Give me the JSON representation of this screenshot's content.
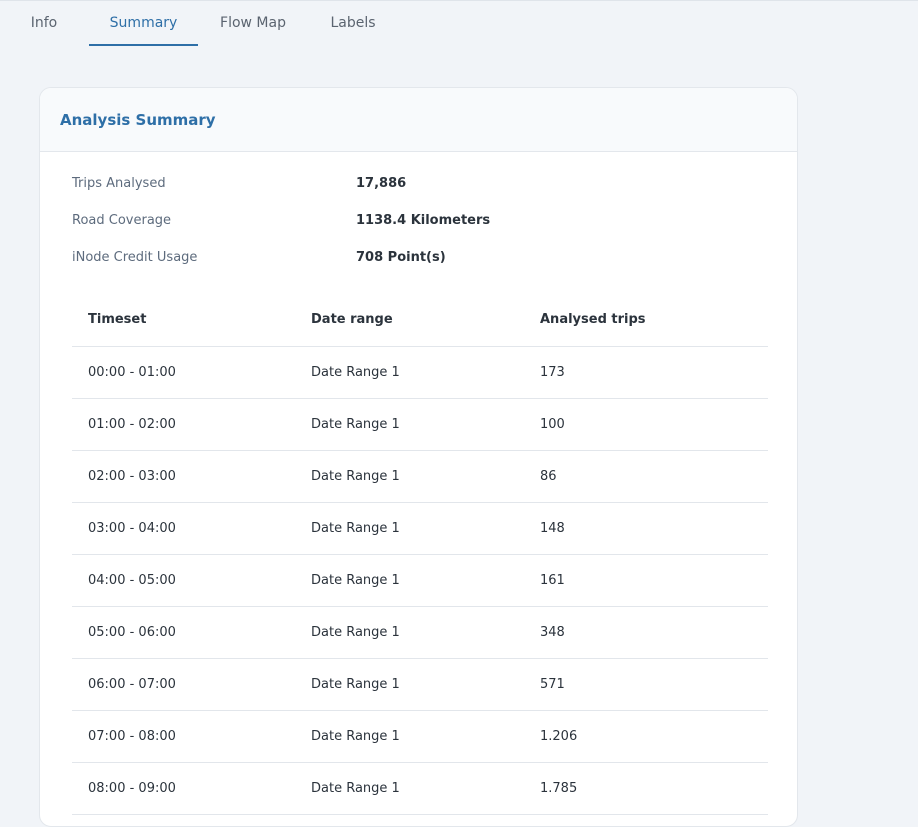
{
  "tabs": [
    {
      "label": "Info"
    },
    {
      "label": "Summary",
      "active": true
    },
    {
      "label": "Flow Map"
    },
    {
      "label": "Labels"
    }
  ],
  "card": {
    "title": "Analysis Summary",
    "stats": [
      {
        "label": "Trips Analysed",
        "value": "17,886"
      },
      {
        "label": "Road Coverage",
        "value": "1138.4 Kilometers"
      },
      {
        "label": "iNode Credit Usage",
        "value": "708 Point(s)"
      }
    ]
  },
  "table": {
    "headers": [
      "Timeset",
      "Date range",
      "Analysed trips"
    ],
    "rows": [
      [
        "00:00 - 01:00",
        "Date Range 1",
        "173"
      ],
      [
        "01:00 - 02:00",
        "Date Range 1",
        "100"
      ],
      [
        "02:00 - 03:00",
        "Date Range 1",
        "86"
      ],
      [
        "03:00 - 04:00",
        "Date Range 1",
        "148"
      ],
      [
        "04:00 - 05:00",
        "Date Range 1",
        "161"
      ],
      [
        "05:00 - 06:00",
        "Date Range 1",
        "348"
      ],
      [
        "06:00 - 07:00",
        "Date Range 1",
        "571"
      ],
      [
        "07:00 - 08:00",
        "Date Range 1",
        "1.206"
      ],
      [
        "08:00 - 09:00",
        "Date Range 1",
        "1.785"
      ]
    ]
  },
  "colors": {
    "accent": "#2e6fa7",
    "background": "#f1f4f8",
    "card": "#ffffff"
  }
}
